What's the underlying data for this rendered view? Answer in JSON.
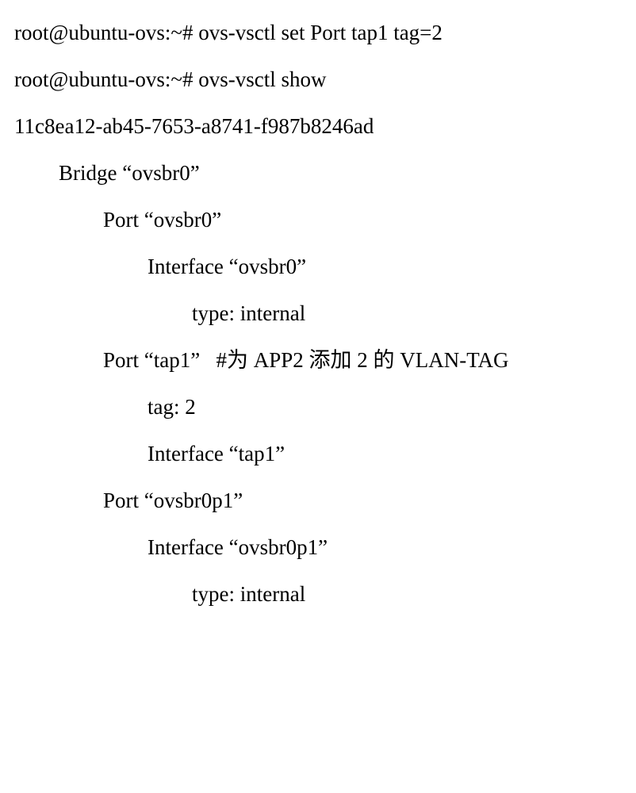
{
  "lines": {
    "l1": "root@ubuntu-ovs:~# ovs-vsctl set Port tap1 tag=2",
    "l2": "root@ubuntu-ovs:~# ovs-vsctl show",
    "l3": "11c8ea12-ab45-7653-a8741-f987b8246ad",
    "l4": "Bridge “ovsbr0”",
    "l5": "Port “ovsbr0”",
    "l6": "Interface “ovsbr0”",
    "l7": "type: internal",
    "l8": "Port “tap1”   #为 APP2 添加 2 的 VLAN-TAG",
    "l9": "tag: 2",
    "l10": "Interface “tap1”",
    "l11": "Port “ovsbr0p1”",
    "l12": "Interface “ovsbr0p1”",
    "l13": "type: internal"
  }
}
